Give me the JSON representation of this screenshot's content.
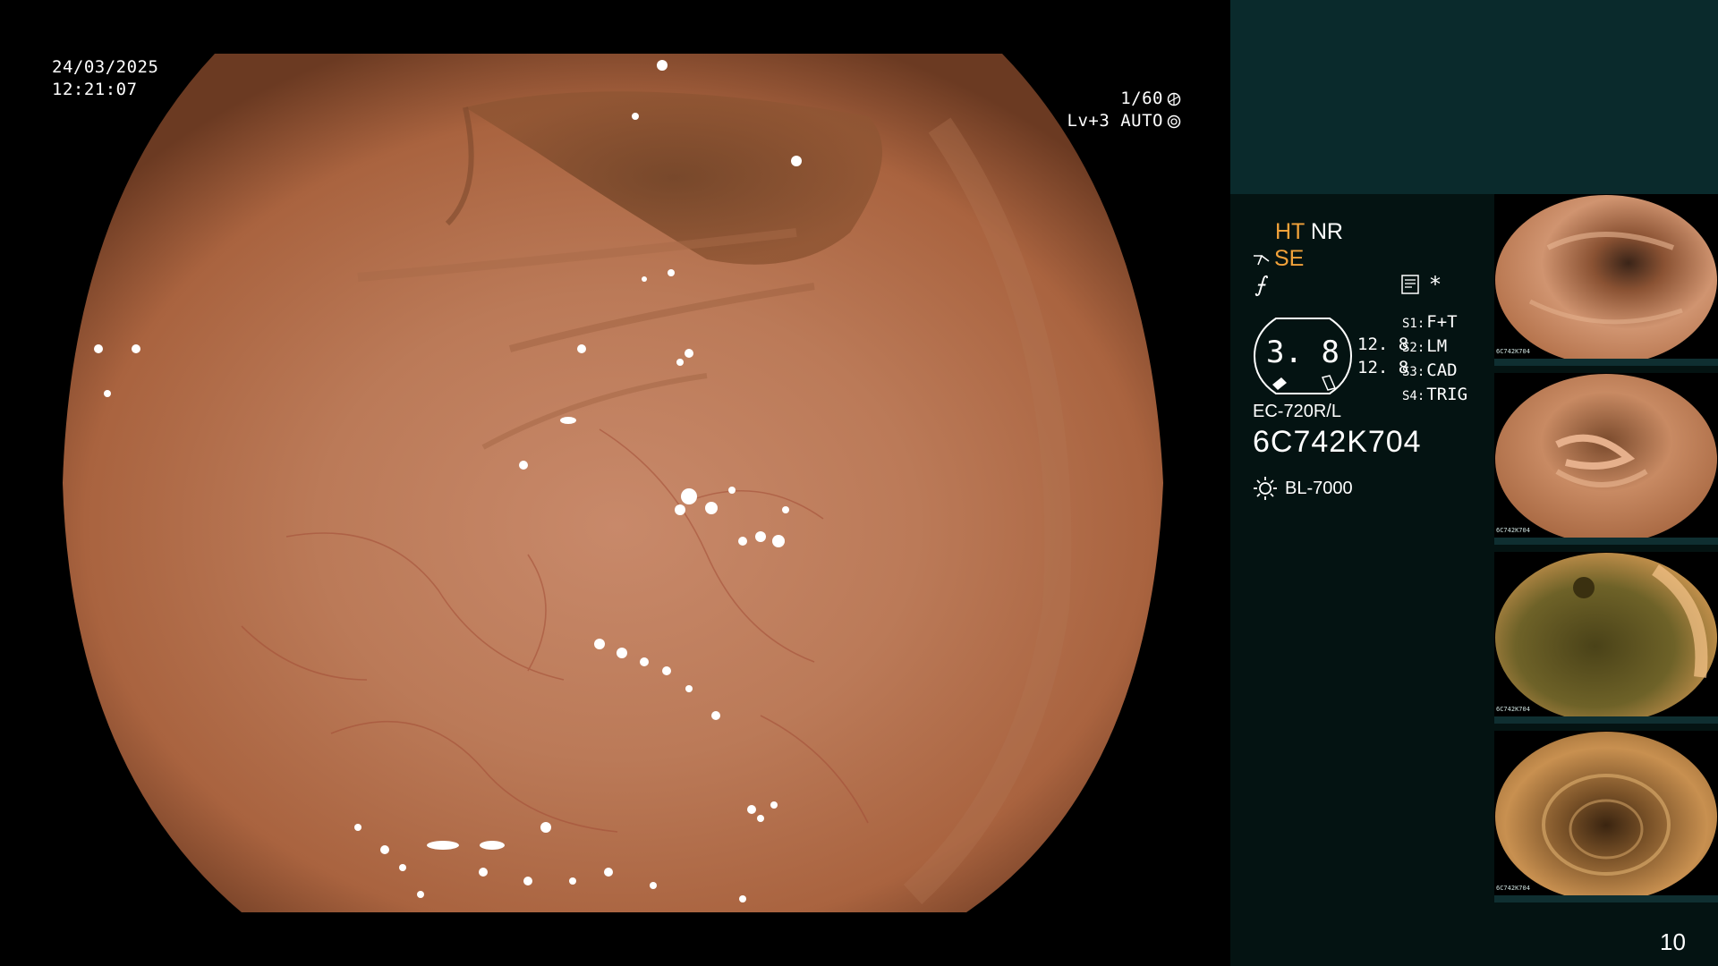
{
  "overlay": {
    "date": "24/03/2025",
    "time": "12:21:07",
    "shutter": "1/60",
    "level": "Lv+3 AUTO"
  },
  "panel": {
    "ht": "HT",
    "nr": "NR",
    "se": "SE",
    "f_symbol": "⨍",
    "star": "*",
    "gauge_value": "3. 8",
    "gauge_nums": [
      "12. 8",
      "12. 8"
    ],
    "settings": [
      {
        "key": "S1:",
        "value": "F+T"
      },
      {
        "key": "S2:",
        "value": "LM"
      },
      {
        "key": "S3:",
        "value": "CAD"
      },
      {
        "key": "S4:",
        "value": "TRIG"
      }
    ],
    "model": "EC-720R/L",
    "serial": "6C742K704",
    "light_source": "BL-7000"
  },
  "thumbnails": [
    {
      "tag": "6C742K704"
    },
    {
      "tag": "6C742K704"
    },
    {
      "tag": "6C742K704"
    },
    {
      "tag": "6C742K704"
    }
  ],
  "page_number": "10",
  "colors": {
    "accent_orange": "#f2a23a",
    "panel_dark": "#041312",
    "panel_teal": "#0a2a2c"
  }
}
